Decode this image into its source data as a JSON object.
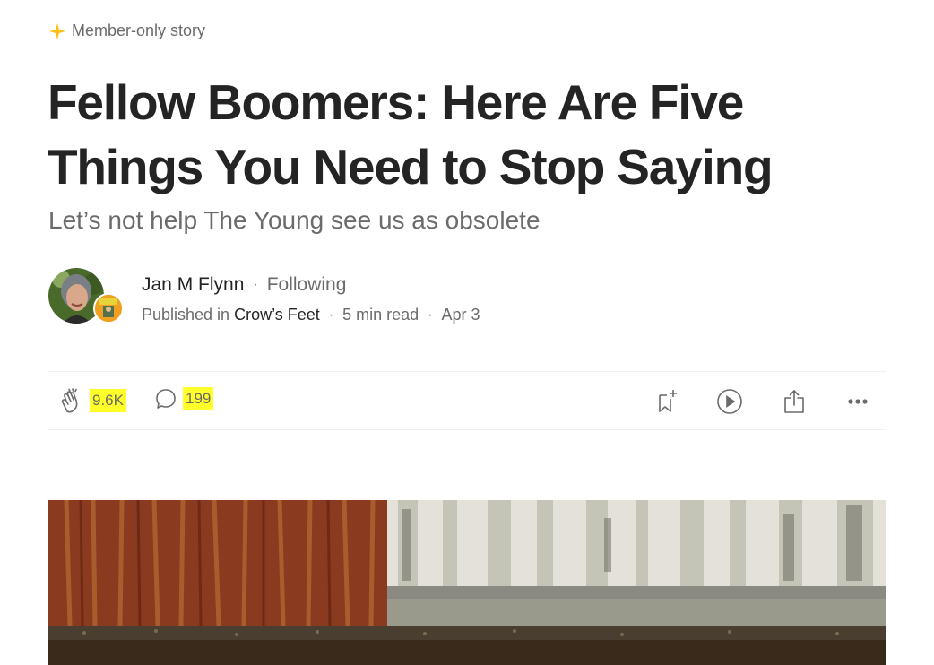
{
  "member_label": "Member-only story",
  "article": {
    "title_line1": "Fellow Boomers: Here Are Five",
    "title_line2": "Things You Need to Stop Saying",
    "subtitle": "Let’s not help The Young see us as obsolete"
  },
  "author": {
    "name": "Jan M Flynn",
    "separator": "·",
    "follow_status": "Following",
    "published_in_label": "Published in",
    "publication": "Crow’s Feet",
    "read_time": "5 min read",
    "date": "Apr 3"
  },
  "actions": {
    "claps": "9.6K",
    "responses": "199"
  },
  "colors": {
    "accent_star": "#ffc017",
    "highlight": "#ffff2a",
    "text_primary": "#242424",
    "text_secondary": "#6b6b6b"
  },
  "icons": [
    "sparkle-star-icon",
    "clap-icon",
    "comment-icon",
    "bookmark-add-icon",
    "play-listen-icon",
    "share-icon",
    "more-options-icon"
  ]
}
